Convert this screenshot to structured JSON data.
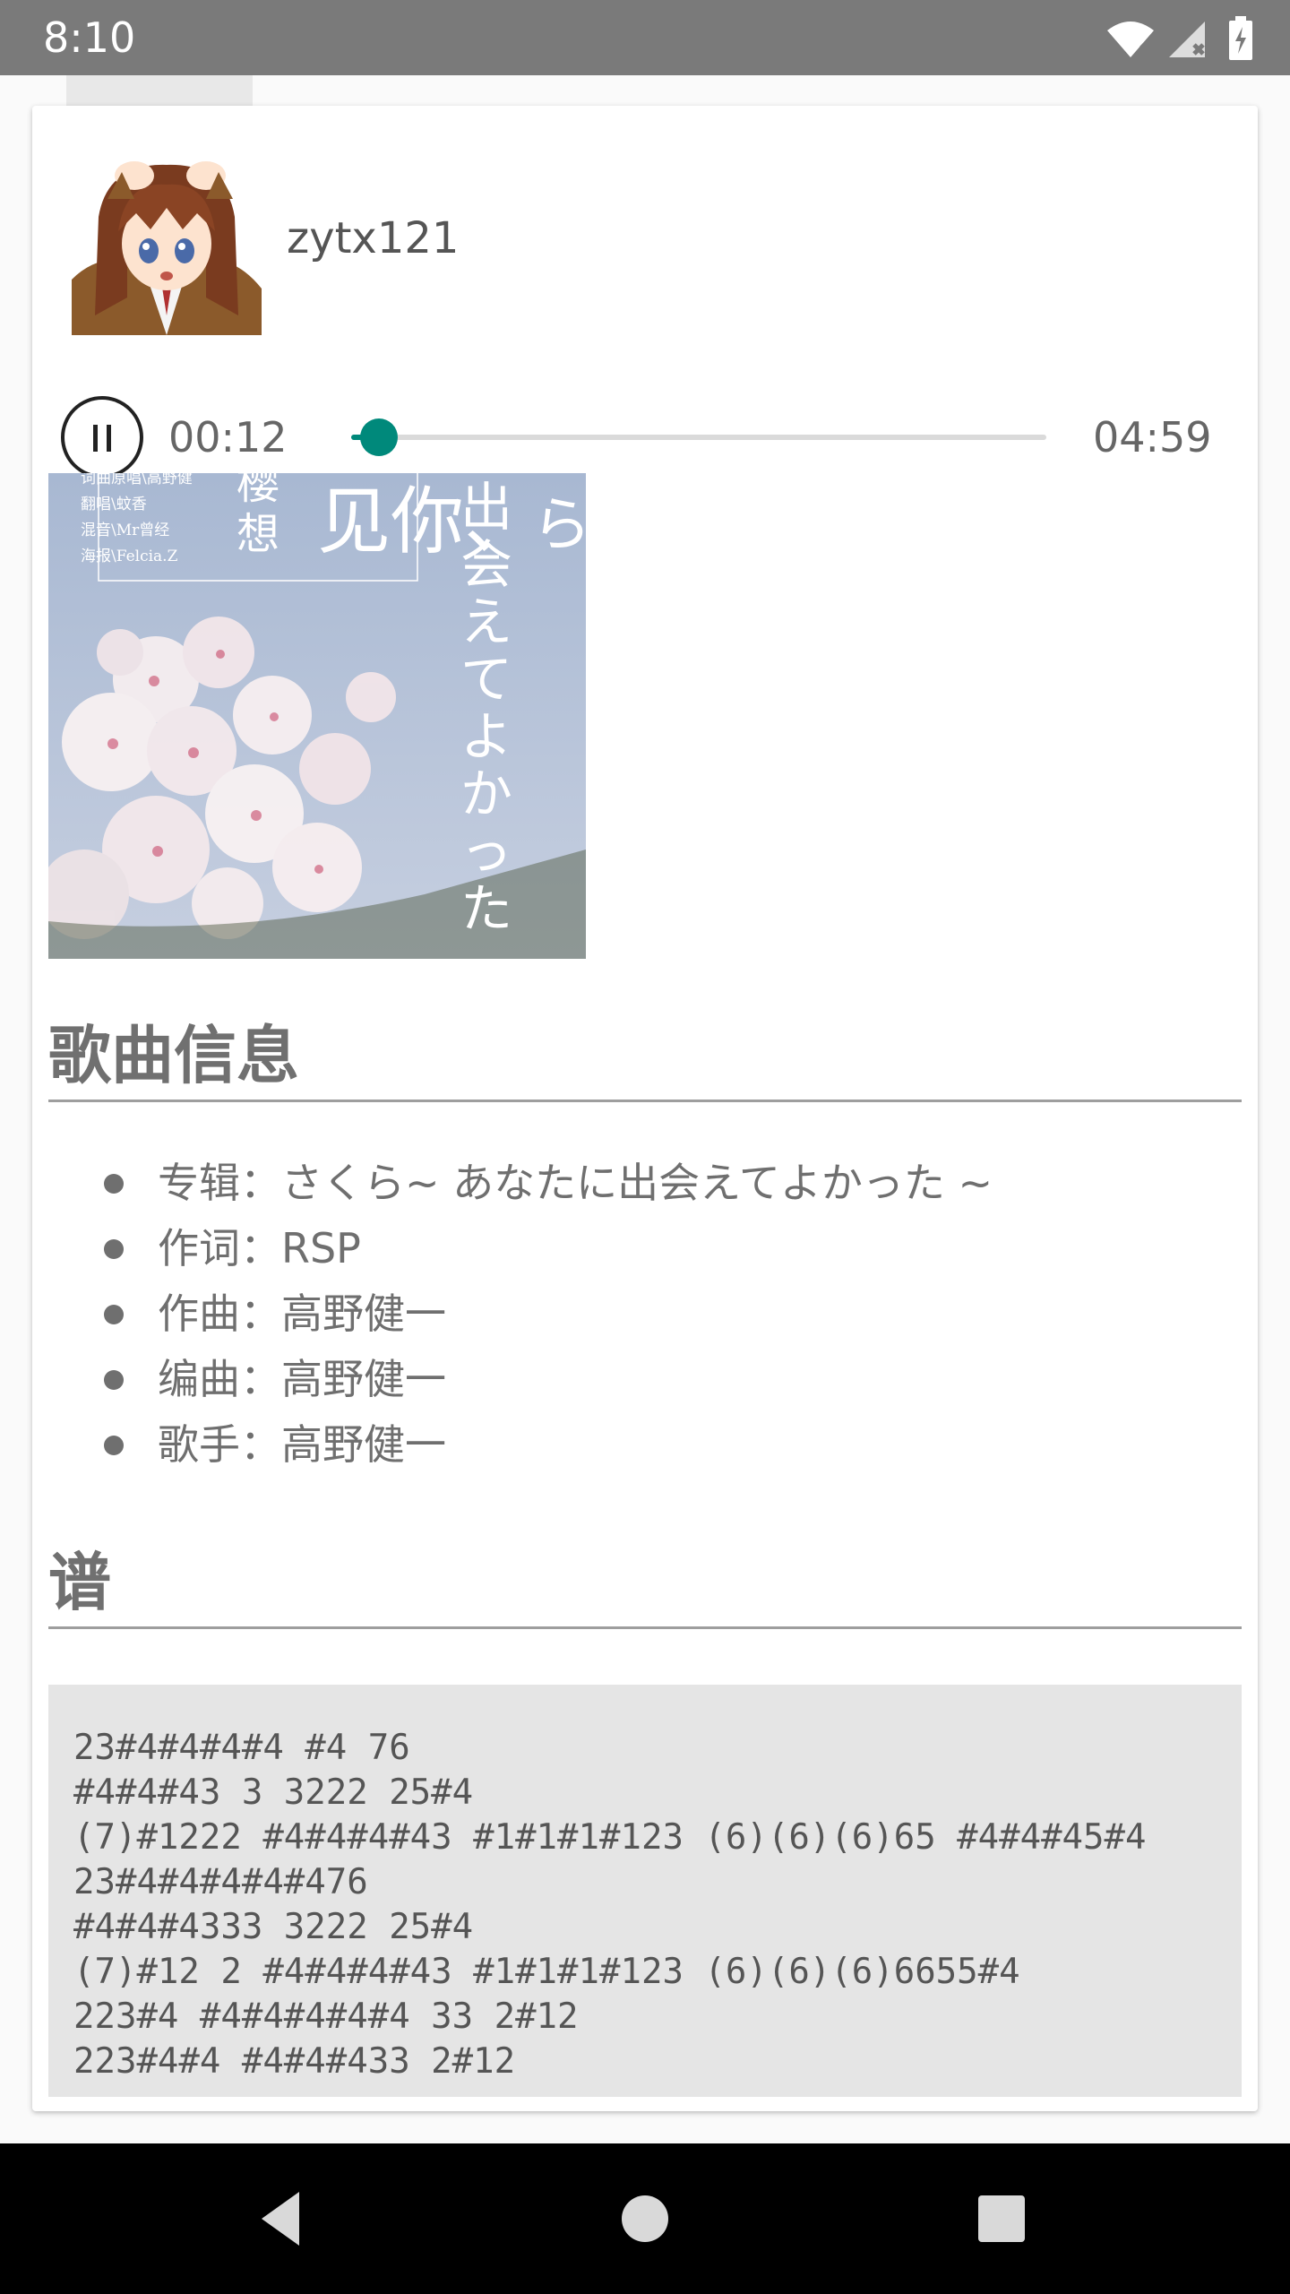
{
  "status_bar": {
    "time": "8:10"
  },
  "profile": {
    "username": "zytx121"
  },
  "player": {
    "current_time": "00:12",
    "total_time": "04:59",
    "progress_fraction": 0.04,
    "accent_color": "#00897b",
    "button_icon": "pause-icon"
  },
  "cover": {
    "credits": [
      "词曲原唱\\高野健",
      "翻唱\\蚊香",
      "混音\\Mr曾经",
      "海报\\Felcia.Z"
    ],
    "title_chars_left": "樱想",
    "title_chars_mid": "见你、",
    "title_vertical": "出会えてよかった",
    "title_ra": "ら"
  },
  "song_info": {
    "heading": "歌曲信息",
    "items": [
      "专辑：さくら~ あなたに出会えてよかった ~",
      "作词：RSP",
      "作曲：高野健一",
      "编曲：高野健一",
      "歌手：高野健一"
    ]
  },
  "score": {
    "heading": "谱",
    "lines": [
      "23#4#4#4#4 #4 76",
      "#4#4#43 3 3222 25#4",
      "(7)#1222 #4#4#4#43 #1#1#1#123 (6)(6)(6)65 #4#4#45#4",
      "23#4#4#4#4#476",
      "#4#4#4333 3222 25#4",
      "(7)#12 2 #4#4#4#43 #1#1#1#123 (6)(6)(6)6655#4",
      "223#4 #4#4#4#4#4 33 2#12",
      "223#4#4 #4#4#433 2#12"
    ]
  }
}
